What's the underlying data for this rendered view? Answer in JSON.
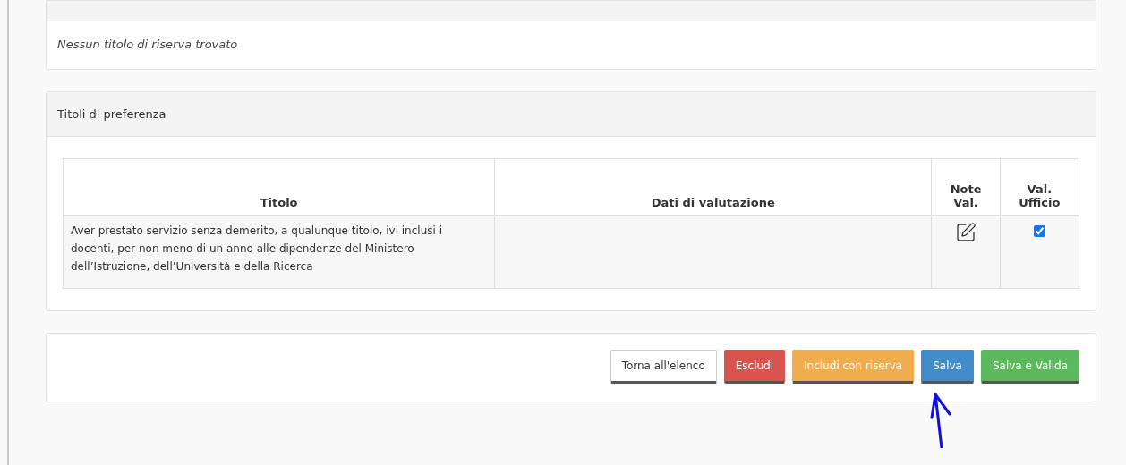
{
  "riserva_panel": {
    "empty_message": "Nessun titolo di riserva trovato"
  },
  "preferenza_panel": {
    "title": "Titoli di preferenza",
    "table": {
      "columns": [
        "Titolo",
        "Dati di valutazione",
        "Note Val.",
        "Val. Ufficio"
      ],
      "rows": [
        {
          "titolo": "Aver prestato servizio senza demerito, a qualunque titolo, ivi inclusi i docenti, per non meno di un anno alle dipendenze del Ministero dell’Istruzione, dell’Università e della Ricerca",
          "val_ufficio_checked": true
        }
      ]
    }
  },
  "actions": [
    {
      "label": "Torna all'elenco",
      "kind": "default"
    },
    {
      "label": "Escludi",
      "kind": "danger"
    },
    {
      "label": "Includi con riserva",
      "kind": "warning"
    },
    {
      "label": "Salva",
      "kind": "primary"
    },
    {
      "label": "Salva e Valida",
      "kind": "success"
    }
  ]
}
